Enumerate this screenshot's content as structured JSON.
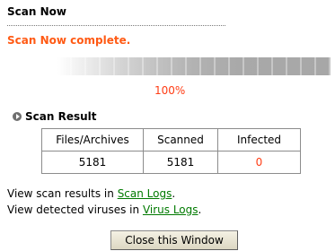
{
  "header": {
    "title": "Scan Now"
  },
  "status": {
    "message": "Scan Now complete."
  },
  "progress": {
    "value": 1.0,
    "label": "100%"
  },
  "result": {
    "heading": "Scan Result",
    "columns": [
      "Files/Archives",
      "Scanned",
      "Infected"
    ],
    "values": [
      "5181",
      "5181",
      "0"
    ]
  },
  "logs": {
    "scan_prefix": "View scan results in ",
    "scan_link": "Scan Logs",
    "scan_suffix": ".",
    "virus_prefix": "View detected viruses in ",
    "virus_link": "Virus Logs",
    "virus_suffix": "."
  },
  "actions": {
    "close_label": "Close this Window"
  },
  "colors": {
    "accent": "#ff5a14",
    "link": "#007a00",
    "infected": "#ff3c14"
  },
  "icons": {
    "section_icon": "circle-arrow-icon"
  }
}
